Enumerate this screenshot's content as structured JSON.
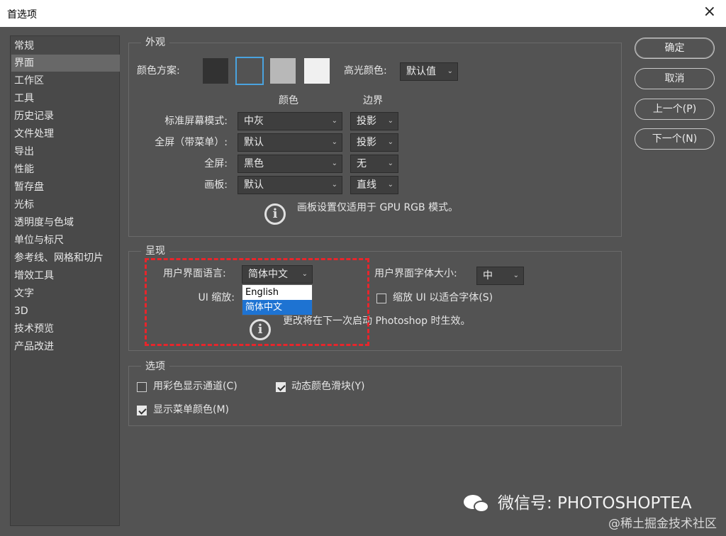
{
  "window": {
    "title": "首选项",
    "close_icon": "×"
  },
  "sidebar": {
    "items": [
      {
        "label": "常规"
      },
      {
        "label": "界面",
        "active": true
      },
      {
        "label": "工作区"
      },
      {
        "label": "工具"
      },
      {
        "label": "历史记录"
      },
      {
        "label": "文件处理"
      },
      {
        "label": "导出"
      },
      {
        "label": "性能"
      },
      {
        "label": "暂存盘"
      },
      {
        "label": "光标"
      },
      {
        "label": "透明度与色域"
      },
      {
        "label": "单位与标尺"
      },
      {
        "label": "参考线、网格和切片"
      },
      {
        "label": "增效工具"
      },
      {
        "label": "文字"
      },
      {
        "label": "3D"
      },
      {
        "label": "技术预览"
      },
      {
        "label": "产品改进"
      }
    ]
  },
  "appearance": {
    "legend": "外观",
    "color_scheme_label": "颜色方案:",
    "swatches": [
      {
        "color": "#323232",
        "selected": false
      },
      {
        "color": "#535353",
        "selected": true
      },
      {
        "color": "#b8b8b8",
        "selected": false
      },
      {
        "color": "#f0f0f0",
        "selected": false
      }
    ],
    "highlight_color_label": "高光颜色:",
    "highlight_color_value": "默认值",
    "col_color": "颜色",
    "col_border": "边界",
    "rows": [
      {
        "label": "标准屏幕模式:",
        "color": "中灰",
        "border": "投影"
      },
      {
        "label": "全屏（带菜单）:",
        "color": "默认",
        "border": "投影"
      },
      {
        "label": "全屏:",
        "color": "黑色",
        "border": "无"
      },
      {
        "label": "画板:",
        "color": "默认",
        "border": "直线"
      }
    ],
    "note": "画板设置仅适用于 GPU RGB 模式。"
  },
  "presentation": {
    "legend": "呈现",
    "ui_language_label": "用户界面语言:",
    "ui_language_value": "简体中文",
    "ui_language_options": [
      "English",
      "简体中文"
    ],
    "ui_font_size_label": "用户界面字体大小:",
    "ui_font_size_value": "中",
    "ui_scale_label": "UI 缩放:",
    "scale_to_font_label": "缩放 UI 以适合字体(S)",
    "scale_to_font_checked": false,
    "note": "更改将在下一次启动 Photoshop 时生效。"
  },
  "options": {
    "legend": "选项",
    "channels_in_color_label": "用彩色显示通道(C)",
    "channels_in_color_checked": false,
    "dynamic_sliders_label": "动态颜色滑块(Y)",
    "dynamic_sliders_checked": true,
    "menu_colors_label": "显示菜单颜色(M)",
    "menu_colors_checked": true
  },
  "buttons": {
    "ok": "确定",
    "cancel": "取消",
    "prev": "上一个(P)",
    "next": "下一个(N)"
  },
  "watermark": {
    "text": "微信号: PHOTOSHOPTEA",
    "credit": "@稀土掘金技术社区"
  },
  "colors": {
    "background": "#535353",
    "accent": "#1e73d2",
    "annotation": "#e8252b"
  }
}
